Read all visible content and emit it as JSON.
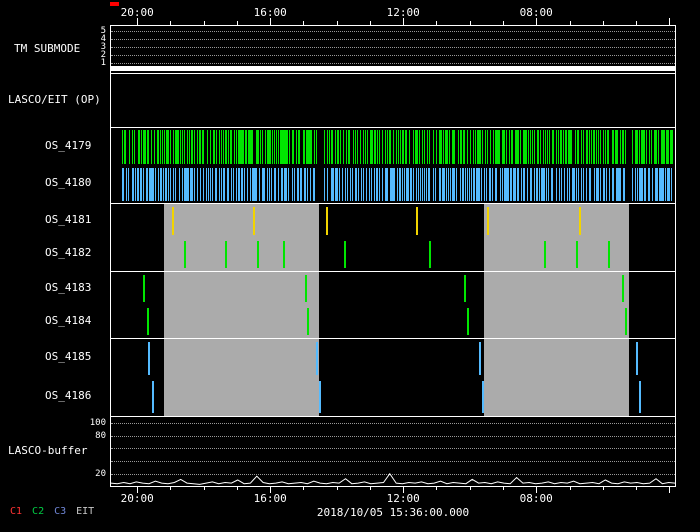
{
  "chart_data": {
    "type": "timeline",
    "datetime_label": "2018/10/05 15:36:00.000",
    "x_axis": {
      "tick_labels": [
        "20:00",
        "16:00",
        "12:00",
        "08:00"
      ],
      "tick_fractions": [
        0.048,
        0.283,
        0.518,
        0.753
      ],
      "minor_ticks_per_interval": 4
    },
    "colors": {
      "background": "#000000",
      "frame": "#ffffff",
      "green": "#00e600",
      "blue": "#55bbff",
      "yellow": "#f2d400",
      "gray_block": "#ababab",
      "trace": "#ffffff",
      "marker": "#ff0000",
      "grid": "rgba(255,255,255,0.6)"
    },
    "panels": [
      {
        "id": "tm_submode",
        "label": "TM SUBMODE",
        "type": "submode",
        "tick_labels": [
          "5",
          "4",
          "3",
          "2",
          "1"
        ],
        "bar_color": "#ffffff"
      },
      {
        "id": "lasco_eit",
        "label": "LASCO/EIT (OP)",
        "type": "empty"
      },
      {
        "id": "os_4179_80",
        "type": "rows",
        "rows": [
          {
            "label": "OS_4179",
            "kind": "barcode",
            "color_key": "green",
            "segments": [
              [
                0.02,
                0.365
              ],
              [
                0.378,
                0.912
              ],
              [
                0.924,
                0.995
              ]
            ]
          },
          {
            "label": "OS_4180",
            "kind": "barcode",
            "color_key": "blue",
            "segments": [
              [
                0.02,
                0.365
              ],
              [
                0.378,
                0.912
              ],
              [
                0.924,
                0.995
              ]
            ]
          }
        ]
      },
      {
        "id": "os_4181_82",
        "type": "rows",
        "blocks": [
          [
            0.094,
            0.368
          ],
          [
            0.662,
            0.919
          ]
        ],
        "rows": [
          {
            "label": "OS_4181",
            "kind": "events",
            "color_key": "yellow",
            "positions": [
              0.11,
              0.253,
              0.383,
              0.542,
              0.669,
              0.832
            ]
          },
          {
            "label": "OS_4182",
            "kind": "events",
            "color_key": "green",
            "positions": [
              0.132,
              0.203,
              0.261,
              0.306,
              0.415,
              0.565,
              0.77,
              0.827,
              0.883
            ]
          }
        ]
      },
      {
        "id": "os_4183_84",
        "type": "rows",
        "blocks": [
          [
            0.094,
            0.368
          ],
          [
            0.662,
            0.919
          ]
        ],
        "rows": [
          {
            "label": "OS_4183",
            "kind": "events",
            "color_key": "green",
            "positions": [
              0.058,
              0.345,
              0.627,
              0.908
            ]
          },
          {
            "label": "OS_4184",
            "kind": "events",
            "color_key": "green",
            "positions": [
              0.065,
              0.35,
              0.633,
              0.913
            ]
          }
        ]
      },
      {
        "id": "os_4185_86",
        "type": "rows",
        "blocks": [
          [
            0.094,
            0.368
          ],
          [
            0.662,
            0.919
          ]
        ],
        "rows": [
          {
            "label": "OS_4185",
            "kind": "events",
            "color_key": "blue",
            "positions": [
              0.067,
              0.366,
              0.654,
              0.933
            ]
          },
          {
            "label": "OS_4186",
            "kind": "events",
            "color_key": "blue",
            "positions": [
              0.074,
              0.371,
              0.659,
              0.938
            ]
          }
        ]
      },
      {
        "id": "lasco_buffer",
        "label": "LASCO-buffer",
        "type": "line",
        "ylim": [
          0,
          110
        ],
        "gridline_values": [
          100,
          80,
          60,
          40,
          20
        ],
        "tick_labels": [
          {
            "value": 100,
            "label": "100"
          },
          {
            "value": 80,
            "label": "80"
          },
          {
            "value": 20,
            "label": "20"
          }
        ],
        "values": [
          3,
          2,
          4,
          2,
          5,
          3,
          2,
          6,
          3,
          2,
          4,
          9,
          3,
          2,
          1,
          3,
          5,
          2,
          4,
          3,
          8,
          2,
          3,
          14,
          4,
          2,
          3,
          5,
          2,
          3,
          4,
          2,
          6,
          3,
          2,
          4,
          3,
          10,
          2,
          3,
          5,
          2,
          3,
          4,
          18,
          3,
          2,
          4,
          3,
          5,
          2,
          3,
          6,
          2,
          4,
          3,
          2,
          9,
          3,
          4,
          2,
          5,
          3,
          2,
          12,
          3,
          4,
          2,
          3,
          5,
          2,
          4,
          3,
          6,
          2,
          3,
          4,
          2,
          8,
          3,
          2,
          5,
          3,
          4,
          2,
          3,
          10,
          2,
          4,
          3
        ]
      }
    ],
    "legend": [
      {
        "label": "C1",
        "color": "#ff3333"
      },
      {
        "label": "C2",
        "color": "#00cc44"
      },
      {
        "label": "C3",
        "color": "#6f86d6"
      },
      {
        "label": "EIT",
        "color": "#c8c8c8"
      }
    ]
  }
}
